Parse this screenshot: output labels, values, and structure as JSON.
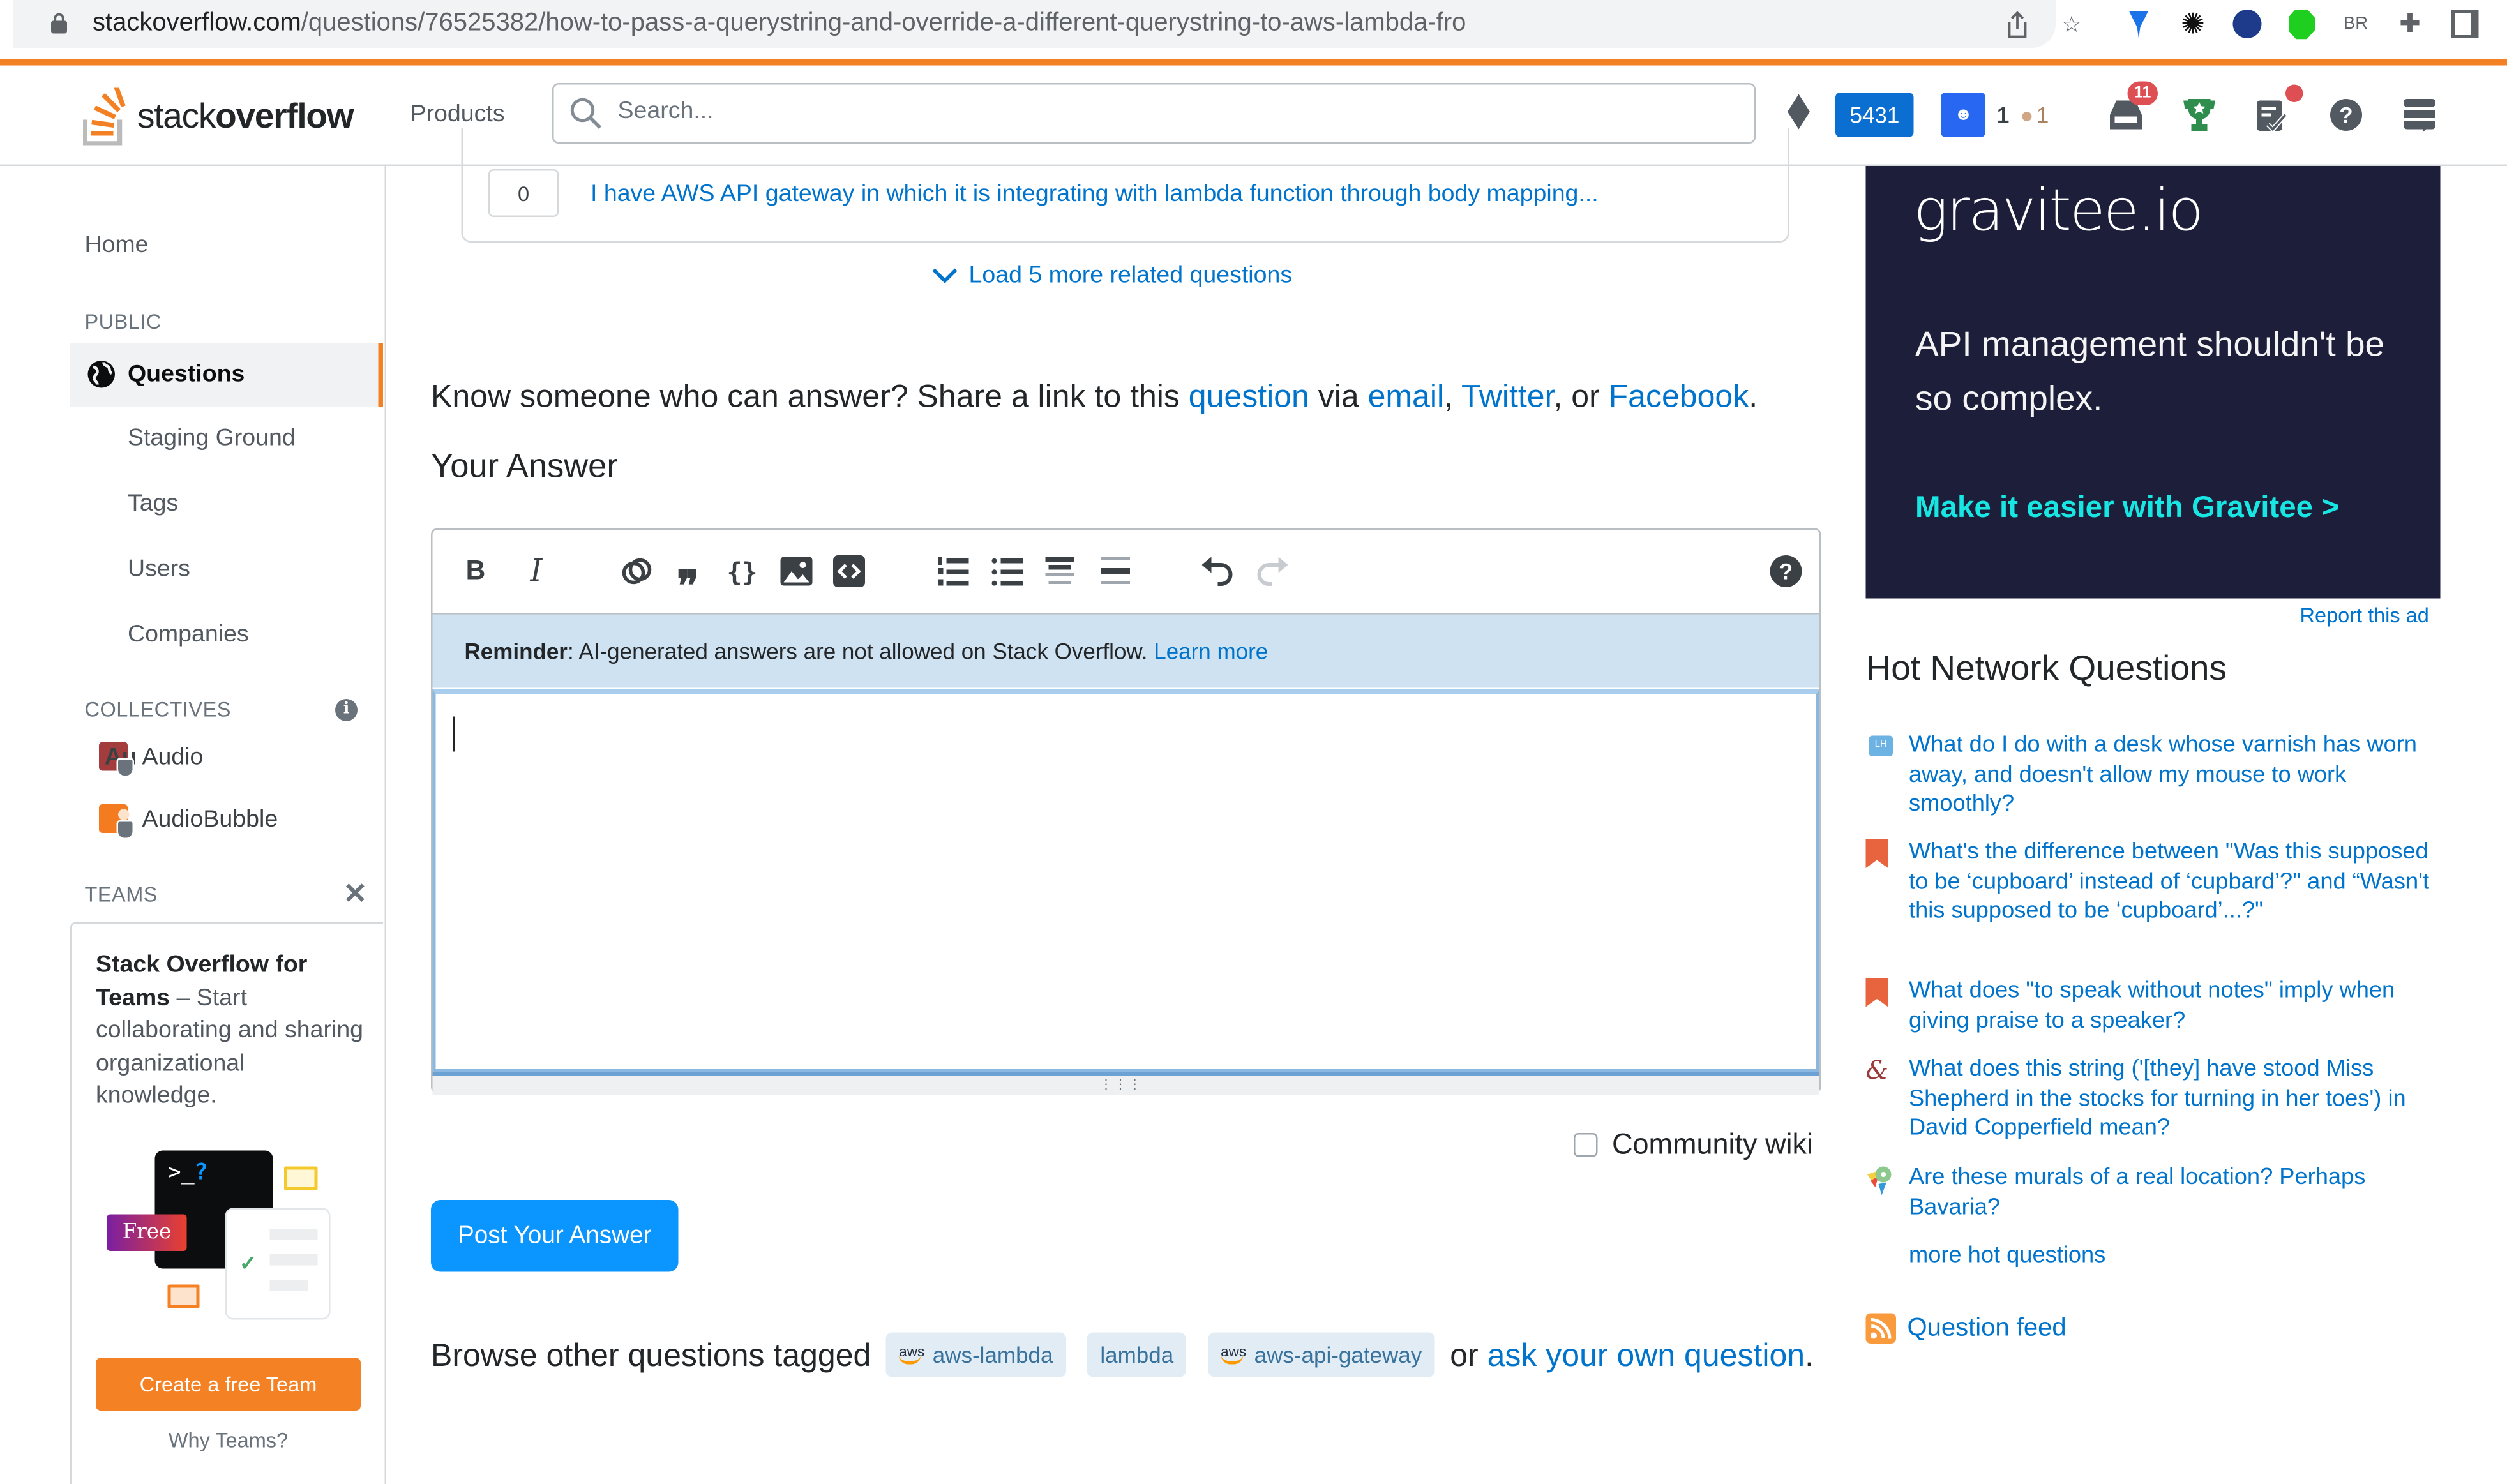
{
  "browser": {
    "url_host": "stackoverflow.com",
    "url_path": "/questions/76525382/how-to-pass-a-querystring-and-override-a-different-querystring-to-aws-lambda-fro",
    "extension_label_br": "BR"
  },
  "header": {
    "logo_light": "stack",
    "logo_bold": "overflow",
    "products_label": "Products",
    "search_placeholder": "Search...",
    "reputation": "5431",
    "user_rep_count": "1",
    "bronze_badges": "1",
    "inbox_count": "11"
  },
  "sidebar": {
    "home": "Home",
    "public_heading": "PUBLIC",
    "questions": "Questions",
    "items": [
      {
        "label": "Staging Ground"
      },
      {
        "label": "Tags"
      },
      {
        "label": "Users"
      },
      {
        "label": "Companies"
      }
    ],
    "collectives_heading": "COLLECTIVES",
    "collectives": [
      {
        "label": "Audio",
        "icon_text": "Au",
        "color": "#a33c3c"
      },
      {
        "label": "AudioBubble",
        "icon_text": "",
        "color": "#f47b20"
      }
    ],
    "teams_heading": "TEAMS",
    "teams_title": "Stack Overflow for Teams",
    "teams_dash": " – Start collaborating and sharing organizational knowledge.",
    "teams_art_prompt": ">_",
    "teams_art_q": "?",
    "teams_art_free": "Free",
    "create_team": "Create a free Team",
    "why_teams": "Why Teams?"
  },
  "main": {
    "related_votes": "0",
    "related_question": "I have AWS API gateway in which it is integrating with lambda function through body mapping...",
    "load_more": "Load 5 more related questions",
    "share_prefix": "Know someone who can answer? Share a link to this ",
    "share_question": "question",
    "share_via": " via ",
    "share_email": "email",
    "share_comma": ", ",
    "share_twitter": "Twitter",
    "share_or": ", or ",
    "share_facebook": "Facebook",
    "share_end": ".",
    "your_answer": "Your Answer",
    "reminder_bold": "Reminder",
    "reminder_text": ": AI-generated answers are not allowed on Stack Overflow. ",
    "reminder_link": "Learn more",
    "answer_value": "",
    "community_wiki": "Community wiki",
    "post_answer": "Post Your Answer",
    "browse_prefix": "Browse other questions tagged ",
    "tags": [
      {
        "label": "aws-lambda",
        "aws": true
      },
      {
        "label": "lambda",
        "aws": false
      },
      {
        "label": "aws-api-gateway",
        "aws": true
      }
    ],
    "browse_or": " or ",
    "ask_own": "ask your own question",
    "browse_end": "."
  },
  "ad": {
    "brand": "gravitee.io",
    "headline": "API management shouldn't be so complex.",
    "cta": "Make it easier with Gravitee >",
    "report": "Report this ad"
  },
  "hot_network": {
    "title": "Hot Network Questions",
    "items": [
      {
        "site": "lifehacks",
        "title": "What do I do with a desk whose varnish has worn away, and doesn't allow my mouse to work smoothly?"
      },
      {
        "site": "english",
        "title": "What's the difference between \"Was this supposed to be ‘cupboard’ instead of ‘cupbard’?\" and “Wasn't this supposed to be ‘cupboard’...?\""
      },
      {
        "site": "english",
        "title": "What does \"to speak without notes\" imply when giving praise to a speaker?"
      },
      {
        "site": "literature",
        "title": "What does this string ('[they] have stood Miss Shepherd in the stocks for turning in her toes') in David Copperfield mean?"
      },
      {
        "site": "travel",
        "title": "Are these murals of a real location? Perhaps Bavaria?"
      }
    ],
    "more": "more hot questions",
    "feed": "Question feed"
  }
}
